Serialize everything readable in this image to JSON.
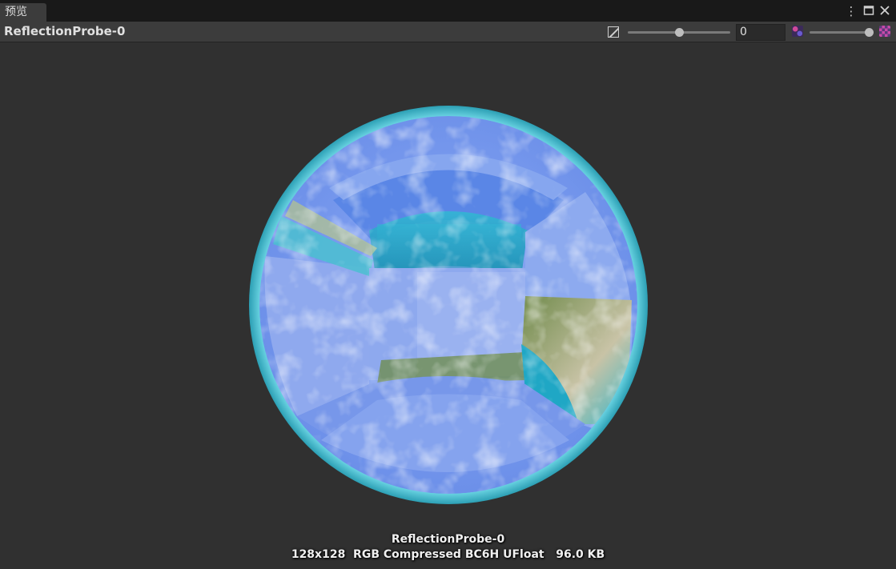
{
  "window": {
    "tab_label": "预览",
    "menu_icon": "kebab-menu-icon",
    "maximize_icon": "maximize-icon",
    "close_icon": "close-icon"
  },
  "toolbar": {
    "title": "ReflectionProbe-0",
    "exposure_icon": "exposure-icon",
    "exposure_slider_value": 0.5,
    "mip_value": "0",
    "mip_low_icon": "mip-low-icon",
    "mip_slider_value": 1.0,
    "mip_high_icon": "mip-high-icon"
  },
  "preview": {
    "object_name": "ReflectionProbe-0",
    "texture_info": "128x128  RGB Compressed BC6H UFloat   96.0 KB"
  },
  "colors": {
    "background": "#303030",
    "header": "#3c3c3c",
    "tabbar": "#191919",
    "sphere_rim": "#4cc4d4"
  }
}
